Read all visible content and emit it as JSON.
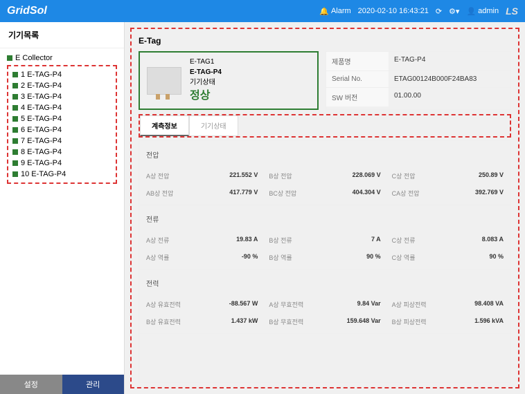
{
  "header": {
    "logo": "GridSol",
    "alarm": "Alarm",
    "datetime": "2020-02-10 16:43:21",
    "user": "admin",
    "brand": "LS"
  },
  "sidebar": {
    "title": "기기목록",
    "root": "E Collector",
    "items": [
      {
        "label": "1 E-TAG-P4"
      },
      {
        "label": "2 E-TAG-P4"
      },
      {
        "label": "3 E-TAG-P4"
      },
      {
        "label": "4 E-TAG-P4"
      },
      {
        "label": "5 E-TAG-P4"
      },
      {
        "label": "6 E-TAG-P4"
      },
      {
        "label": "7 E-TAG-P4"
      },
      {
        "label": "8 E-TAG-P4"
      },
      {
        "label": "9 E-TAG-P4"
      },
      {
        "label": "10 E-TAG-P4"
      }
    ],
    "tab_settings": "설정",
    "tab_manage": "관리"
  },
  "panel": {
    "title": "E-Tag",
    "device": {
      "tag": "E-TAG1",
      "model": "E-TAG-P4",
      "state_label": "기기상태",
      "state": "정상"
    },
    "meta": {
      "product_label": "제품명",
      "product": "E-TAG-P4",
      "serial_label": "Serial No.",
      "serial": "ETAG00124B000F24BA83",
      "sw_label": "SW 버전",
      "sw": "01.00.00"
    },
    "tabs": {
      "measure": "계측정보",
      "status": "기기상태"
    },
    "sections": {
      "voltage": {
        "title": "전압",
        "rows": [
          [
            {
              "l": "A상 전압",
              "v": "221.552 V"
            },
            {
              "l": "B상 전압",
              "v": "228.069 V"
            },
            {
              "l": "C상 전압",
              "v": "250.89 V"
            }
          ],
          [
            {
              "l": "AB상 전압",
              "v": "417.779 V"
            },
            {
              "l": "BC상 전압",
              "v": "404.304 V"
            },
            {
              "l": "CA상 전압",
              "v": "392.769 V"
            }
          ]
        ]
      },
      "current": {
        "title": "전류",
        "rows": [
          [
            {
              "l": "A상 전류",
              "v": "19.83 A"
            },
            {
              "l": "B상 전류",
              "v": "7 A"
            },
            {
              "l": "C상 전류",
              "v": "8.083 A"
            }
          ],
          [
            {
              "l": "A상 역률",
              "v": "-90 %"
            },
            {
              "l": "B상 역률",
              "v": "90 %"
            },
            {
              "l": "C상 역률",
              "v": "90 %"
            }
          ]
        ]
      },
      "power": {
        "title": "전력",
        "rows": [
          [
            {
              "l": "A상 유효전력",
              "v": "-88.567 W"
            },
            {
              "l": "A상 무효전력",
              "v": "9.84 Var"
            },
            {
              "l": "A상 피상전력",
              "v": "98.408 VA"
            }
          ],
          [
            {
              "l": "B상 유효전력",
              "v": "1.437 kW"
            },
            {
              "l": "B상 무효전력",
              "v": "159.648 Var"
            },
            {
              "l": "B상 피상전력",
              "v": "1.596 kVA"
            }
          ]
        ]
      }
    }
  }
}
